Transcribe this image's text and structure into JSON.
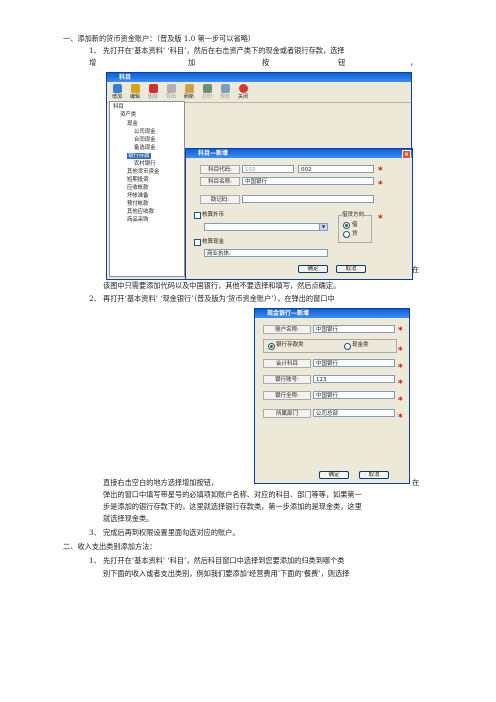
{
  "doc": {
    "l1": "一、添加新的货币资金账户：（普及版 1.0 第一步可以省略）",
    "l2": "1、 先打开在‘基本资料’ ‘科目’，然后在右击资产类下的现金或者银行存款，选择",
    "l3_a": "增",
    "l3_b": "加",
    "l3_c": "按",
    "l3_d": "钮",
    "l3_e": "，",
    "l4_right": "在",
    "l5": "该图中只需要添加代码以及中国银行，其他不要选择和填写，然后点确定。",
    "l6": "2、 再打开‘基本资料’ ‘现金银行’（普及版为‘货币资金账户’），在弹出的窗口中",
    "l7_a": "直接右击空白的地方选择增加按钮，",
    "l7_b": "在",
    "l8": "弹出的窗口中填写带星号的必填项如账户名称、对应的科目、部门等等，如果第一",
    "l9": "步是添加的银行存款下的，这里就选择银行存款类，第一步添加的是现金类，这里",
    "l10": "就选择现金类。",
    "l11": "3、 完成后再到权限设置里面勾选对应的账户。",
    "l12": "二、收入支出类别添加方法：",
    "l13": "1、 先打开在‘基本资料’ ‘科目’，然后科目窗口中选择到您要添加的归类到哪个类",
    "l14": "别下面的收入或者支出类别，例如我们要添加‘经营费用’下面的‘餐费’，则选择"
  },
  "win1": {
    "title": "科目",
    "toolbar": [
      "增加",
      "编辑",
      "删除",
      "导出",
      "刷新",
      "打印",
      "预览",
      "关闭"
    ],
    "tree": [
      "科目",
      "资产类",
      "现金",
      "公司现金",
      "合同现金",
      "备选现金",
      "银行存款",
      "农村银行",
      "其他货币资金",
      "短期投资",
      "应收帐款",
      "坏帐准备",
      "预付帐款",
      "其他应收款",
      "商品采购"
    ]
  },
  "dlg1": {
    "title": "科目—新增",
    "code_label": "科目代码:",
    "code_prefix": "102",
    "code_value": "002",
    "name_label": "科目名称:",
    "name_value": "中国银行",
    "memo_label": "助记码:",
    "foreign_label": "核算外币",
    "currency_label": "外币:",
    "bank_label": "核算现金",
    "category_value": "商业执体:",
    "direction_title": "借贷方向",
    "dir_debit": "借",
    "dir_credit": "贷",
    "ok": "确定",
    "cancel": "取消",
    "star": "*"
  },
  "dlg2": {
    "title": "现金银行—新增",
    "acct_name_label": "账户名称:",
    "acct_name_value": "中国银行",
    "type_bank": "银行存款类",
    "type_cash": "现金类",
    "subject_label": "会计科目",
    "subject_value": "中国银行",
    "bank_acct_label": "银行账号:",
    "bank_acct_value": "123",
    "bank_full_label": "银行全称:",
    "bank_full_value": "中国银行",
    "dept_label": "所属部门",
    "dept_value": "公司总部",
    "ok": "确定",
    "cancel": "取消",
    "star": "*"
  },
  "colors": {
    "accent": "#0a5fd6",
    "star": "#e00000",
    "window": "#ece9d8"
  }
}
